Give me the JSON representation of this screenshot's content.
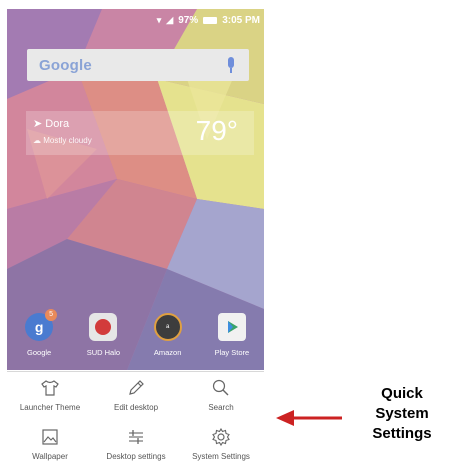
{
  "status_bar": {
    "battery_percent": "97%",
    "time": "3:05 PM"
  },
  "search_widget": {
    "logo_text": "Google"
  },
  "weather_widget": {
    "location": "Dora",
    "condition": "Mostly cloudy",
    "temperature": "79°"
  },
  "dock_apps": [
    {
      "label": "Google",
      "badge": "5"
    },
    {
      "label": "SUD Halo"
    },
    {
      "label": "Amazon"
    },
    {
      "label": "Play Store"
    }
  ],
  "quick_settings": [
    {
      "label": "Launcher Theme",
      "icon": "tshirt-icon"
    },
    {
      "label": "Edit desktop",
      "icon": "pencil-icon"
    },
    {
      "label": "Search",
      "icon": "search-icon"
    },
    {
      "label": "Wallpaper",
      "icon": "image-icon"
    },
    {
      "label": "Desktop settings",
      "icon": "sliders-icon"
    },
    {
      "label": "System Settings",
      "icon": "gear-icon"
    }
  ],
  "annotation": {
    "line1": "Quick",
    "line2": "System",
    "line3": "Settings"
  },
  "colors": {
    "arrow": "#cc2222",
    "accent": "#6f8edb"
  }
}
